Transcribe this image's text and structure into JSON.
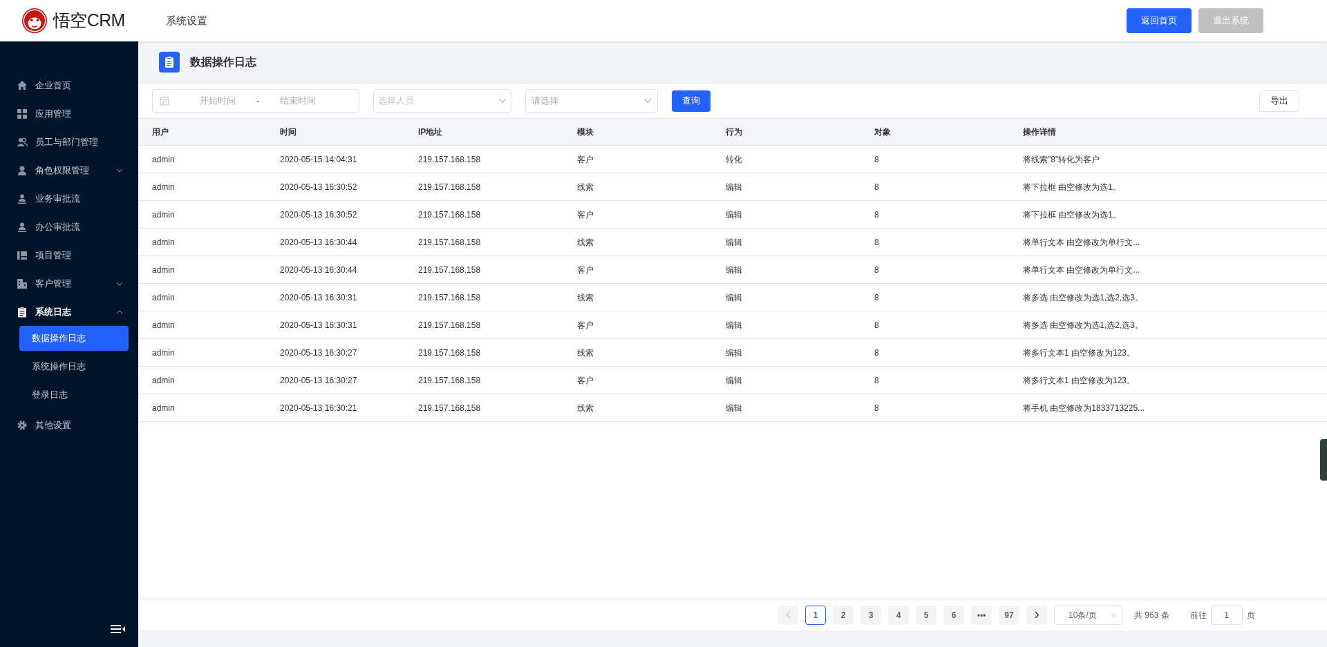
{
  "header": {
    "logo_text": "悟空CRM",
    "section": "系统设置",
    "buttons": [
      {
        "label": "返回首页",
        "disabled": false
      },
      {
        "label": "退出系统",
        "disabled": true
      }
    ]
  },
  "sidebar": {
    "items": [
      {
        "label": "企业首页",
        "kind": "home"
      },
      {
        "label": "应用管理",
        "kind": "grid"
      },
      {
        "label": "员工与部门管理",
        "kind": "users"
      },
      {
        "label": "角色权限管理",
        "kind": "user",
        "expanded": false
      },
      {
        "label": "业务审批流",
        "kind": "stamp"
      },
      {
        "label": "办公审批流",
        "kind": "stamp"
      },
      {
        "label": "项目管理",
        "kind": "board"
      },
      {
        "label": "客户管理",
        "kind": "building",
        "expanded": false
      },
      {
        "label": "系统日志",
        "kind": "clipboard",
        "expanded": true,
        "children": [
          {
            "label": "数据操作日志",
            "selected": true
          },
          {
            "label": "系统操作日志",
            "selected": false
          },
          {
            "label": "登录日志",
            "selected": false
          }
        ]
      },
      {
        "label": "其他设置",
        "kind": "gear"
      }
    ]
  },
  "page_title": "数据操作日志",
  "filters": {
    "start_placeholder": "开始时间",
    "separator": "-",
    "end_placeholder": "结束时间",
    "person_placeholder": "选择人员",
    "select_placeholder": "请选择",
    "search_button": "查询",
    "export_button": "导出"
  },
  "table": {
    "columns": [
      "用户",
      "时间",
      "IP地址",
      "模块",
      "行为",
      "对象",
      "操作详情"
    ],
    "rows": [
      {
        "cells": [
          "admin",
          "2020-05-15 14:04:31",
          "219.157.168.158",
          "客户",
          "转化",
          "8",
          "将线索\"8\"转化为客户"
        ]
      },
      {
        "cells": [
          "admin",
          "2020-05-13 16:30:52",
          "219.157.168.158",
          "线索",
          "编辑",
          "8",
          "将下拉框 由空修改为选1。"
        ]
      },
      {
        "cells": [
          "admin",
          "2020-05-13 16:30:52",
          "219.157.168.158",
          "客户",
          "编辑",
          "8",
          "将下拉框 由空修改为选1。"
        ]
      },
      {
        "cells": [
          "admin",
          "2020-05-13 16:30:44",
          "219.157.168.158",
          "线索",
          "编辑",
          "8",
          "将单行文本 由空修改为单行文..."
        ]
      },
      {
        "cells": [
          "admin",
          "2020-05-13 16:30:44",
          "219.157.168.158",
          "客户",
          "编辑",
          "8",
          "将单行文本 由空修改为单行文..."
        ]
      },
      {
        "cells": [
          "admin",
          "2020-05-13 16:30:31",
          "219.157.168.158",
          "线索",
          "编辑",
          "8",
          "将多选 由空修改为选1,选2,选3。"
        ]
      },
      {
        "cells": [
          "admin",
          "2020-05-13 16:30:31",
          "219.157.168.158",
          "客户",
          "编辑",
          "8",
          "将多选 由空修改为选1,选2,选3。"
        ]
      },
      {
        "cells": [
          "admin",
          "2020-05-13 16:30:27",
          "219.157.168.158",
          "线索",
          "编辑",
          "8",
          "将多行文本1 由空修改为123。"
        ]
      },
      {
        "cells": [
          "admin",
          "2020-05-13 16:30:27",
          "219.157.168.158",
          "客户",
          "编辑",
          "8",
          "将多行文本1 由空修改为123。"
        ]
      },
      {
        "cells": [
          "admin",
          "2020-05-13 16:30:21",
          "219.157.168.158",
          "线索",
          "编辑",
          "8",
          "将手机 由空修改为1833713225..."
        ]
      }
    ]
  },
  "pagination": {
    "prev_disabled": true,
    "pages": [
      {
        "label": "1",
        "selected": true
      },
      {
        "label": "2",
        "selected": false
      },
      {
        "label": "3",
        "selected": false
      },
      {
        "label": "4",
        "selected": false
      },
      {
        "label": "5",
        "selected": false
      },
      {
        "label": "6",
        "selected": false
      },
      {
        "label": "•••",
        "selected": false
      },
      {
        "label": "97",
        "selected": false
      }
    ],
    "page_size": "10条/页",
    "total": "共 963 条",
    "goto_label": "前往",
    "goto_value": "1",
    "goto_suffix": "页"
  }
}
